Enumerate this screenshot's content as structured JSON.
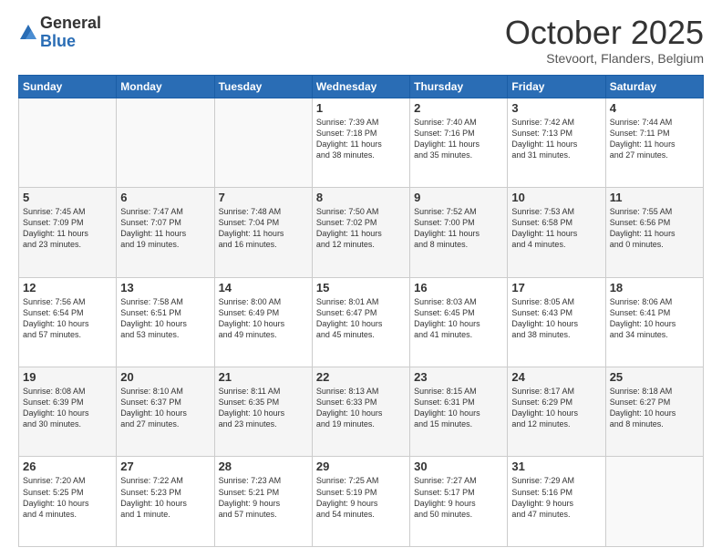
{
  "logo": {
    "general": "General",
    "blue": "Blue"
  },
  "title": "October 2025",
  "location": "Stevoort, Flanders, Belgium",
  "days": [
    "Sunday",
    "Monday",
    "Tuesday",
    "Wednesday",
    "Thursday",
    "Friday",
    "Saturday"
  ],
  "weeks": [
    [
      {
        "day": "",
        "info": ""
      },
      {
        "day": "",
        "info": ""
      },
      {
        "day": "",
        "info": ""
      },
      {
        "day": "1",
        "info": "Sunrise: 7:39 AM\nSunset: 7:18 PM\nDaylight: 11 hours\nand 38 minutes."
      },
      {
        "day": "2",
        "info": "Sunrise: 7:40 AM\nSunset: 7:16 PM\nDaylight: 11 hours\nand 35 minutes."
      },
      {
        "day": "3",
        "info": "Sunrise: 7:42 AM\nSunset: 7:13 PM\nDaylight: 11 hours\nand 31 minutes."
      },
      {
        "day": "4",
        "info": "Sunrise: 7:44 AM\nSunset: 7:11 PM\nDaylight: 11 hours\nand 27 minutes."
      }
    ],
    [
      {
        "day": "5",
        "info": "Sunrise: 7:45 AM\nSunset: 7:09 PM\nDaylight: 11 hours\nand 23 minutes."
      },
      {
        "day": "6",
        "info": "Sunrise: 7:47 AM\nSunset: 7:07 PM\nDaylight: 11 hours\nand 19 minutes."
      },
      {
        "day": "7",
        "info": "Sunrise: 7:48 AM\nSunset: 7:04 PM\nDaylight: 11 hours\nand 16 minutes."
      },
      {
        "day": "8",
        "info": "Sunrise: 7:50 AM\nSunset: 7:02 PM\nDaylight: 11 hours\nand 12 minutes."
      },
      {
        "day": "9",
        "info": "Sunrise: 7:52 AM\nSunset: 7:00 PM\nDaylight: 11 hours\nand 8 minutes."
      },
      {
        "day": "10",
        "info": "Sunrise: 7:53 AM\nSunset: 6:58 PM\nDaylight: 11 hours\nand 4 minutes."
      },
      {
        "day": "11",
        "info": "Sunrise: 7:55 AM\nSunset: 6:56 PM\nDaylight: 11 hours\nand 0 minutes."
      }
    ],
    [
      {
        "day": "12",
        "info": "Sunrise: 7:56 AM\nSunset: 6:54 PM\nDaylight: 10 hours\nand 57 minutes."
      },
      {
        "day": "13",
        "info": "Sunrise: 7:58 AM\nSunset: 6:51 PM\nDaylight: 10 hours\nand 53 minutes."
      },
      {
        "day": "14",
        "info": "Sunrise: 8:00 AM\nSunset: 6:49 PM\nDaylight: 10 hours\nand 49 minutes."
      },
      {
        "day": "15",
        "info": "Sunrise: 8:01 AM\nSunset: 6:47 PM\nDaylight: 10 hours\nand 45 minutes."
      },
      {
        "day": "16",
        "info": "Sunrise: 8:03 AM\nSunset: 6:45 PM\nDaylight: 10 hours\nand 41 minutes."
      },
      {
        "day": "17",
        "info": "Sunrise: 8:05 AM\nSunset: 6:43 PM\nDaylight: 10 hours\nand 38 minutes."
      },
      {
        "day": "18",
        "info": "Sunrise: 8:06 AM\nSunset: 6:41 PM\nDaylight: 10 hours\nand 34 minutes."
      }
    ],
    [
      {
        "day": "19",
        "info": "Sunrise: 8:08 AM\nSunset: 6:39 PM\nDaylight: 10 hours\nand 30 minutes."
      },
      {
        "day": "20",
        "info": "Sunrise: 8:10 AM\nSunset: 6:37 PM\nDaylight: 10 hours\nand 27 minutes."
      },
      {
        "day": "21",
        "info": "Sunrise: 8:11 AM\nSunset: 6:35 PM\nDaylight: 10 hours\nand 23 minutes."
      },
      {
        "day": "22",
        "info": "Sunrise: 8:13 AM\nSunset: 6:33 PM\nDaylight: 10 hours\nand 19 minutes."
      },
      {
        "day": "23",
        "info": "Sunrise: 8:15 AM\nSunset: 6:31 PM\nDaylight: 10 hours\nand 15 minutes."
      },
      {
        "day": "24",
        "info": "Sunrise: 8:17 AM\nSunset: 6:29 PM\nDaylight: 10 hours\nand 12 minutes."
      },
      {
        "day": "25",
        "info": "Sunrise: 8:18 AM\nSunset: 6:27 PM\nDaylight: 10 hours\nand 8 minutes."
      }
    ],
    [
      {
        "day": "26",
        "info": "Sunrise: 7:20 AM\nSunset: 5:25 PM\nDaylight: 10 hours\nand 4 minutes."
      },
      {
        "day": "27",
        "info": "Sunrise: 7:22 AM\nSunset: 5:23 PM\nDaylight: 10 hours\nand 1 minute."
      },
      {
        "day": "28",
        "info": "Sunrise: 7:23 AM\nSunset: 5:21 PM\nDaylight: 9 hours\nand 57 minutes."
      },
      {
        "day": "29",
        "info": "Sunrise: 7:25 AM\nSunset: 5:19 PM\nDaylight: 9 hours\nand 54 minutes."
      },
      {
        "day": "30",
        "info": "Sunrise: 7:27 AM\nSunset: 5:17 PM\nDaylight: 9 hours\nand 50 minutes."
      },
      {
        "day": "31",
        "info": "Sunrise: 7:29 AM\nSunset: 5:16 PM\nDaylight: 9 hours\nand 47 minutes."
      },
      {
        "day": "",
        "info": ""
      }
    ]
  ]
}
